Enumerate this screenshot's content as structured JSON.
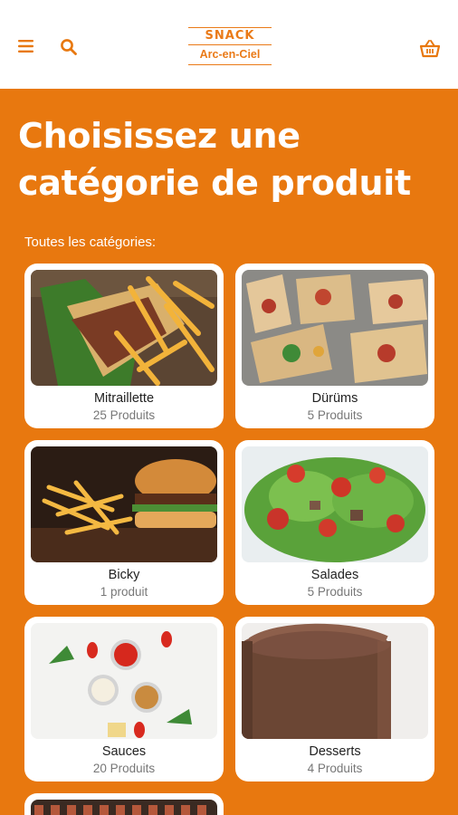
{
  "header": {
    "menu_icon": "hamburger-menu-icon",
    "search_icon": "search-icon",
    "cart_icon": "basket-icon",
    "logo_line1": "SNACK",
    "logo_line2": "Arc-en-Ciel",
    "accent_color": "#e8780f"
  },
  "main": {
    "headline": "Choisissez une catégorie de produit",
    "section_label": "Toutes les catégories:",
    "categories": [
      {
        "name": "Mitraillette",
        "count": "25 Produits"
      },
      {
        "name": "Dürüms",
        "count": "5 Produits"
      },
      {
        "name": "Bicky",
        "count": "1 produit"
      },
      {
        "name": "Salades",
        "count": "5 Produits"
      },
      {
        "name": "Sauces",
        "count": "20 Produits"
      },
      {
        "name": "Desserts",
        "count": "4 Produits"
      }
    ]
  }
}
